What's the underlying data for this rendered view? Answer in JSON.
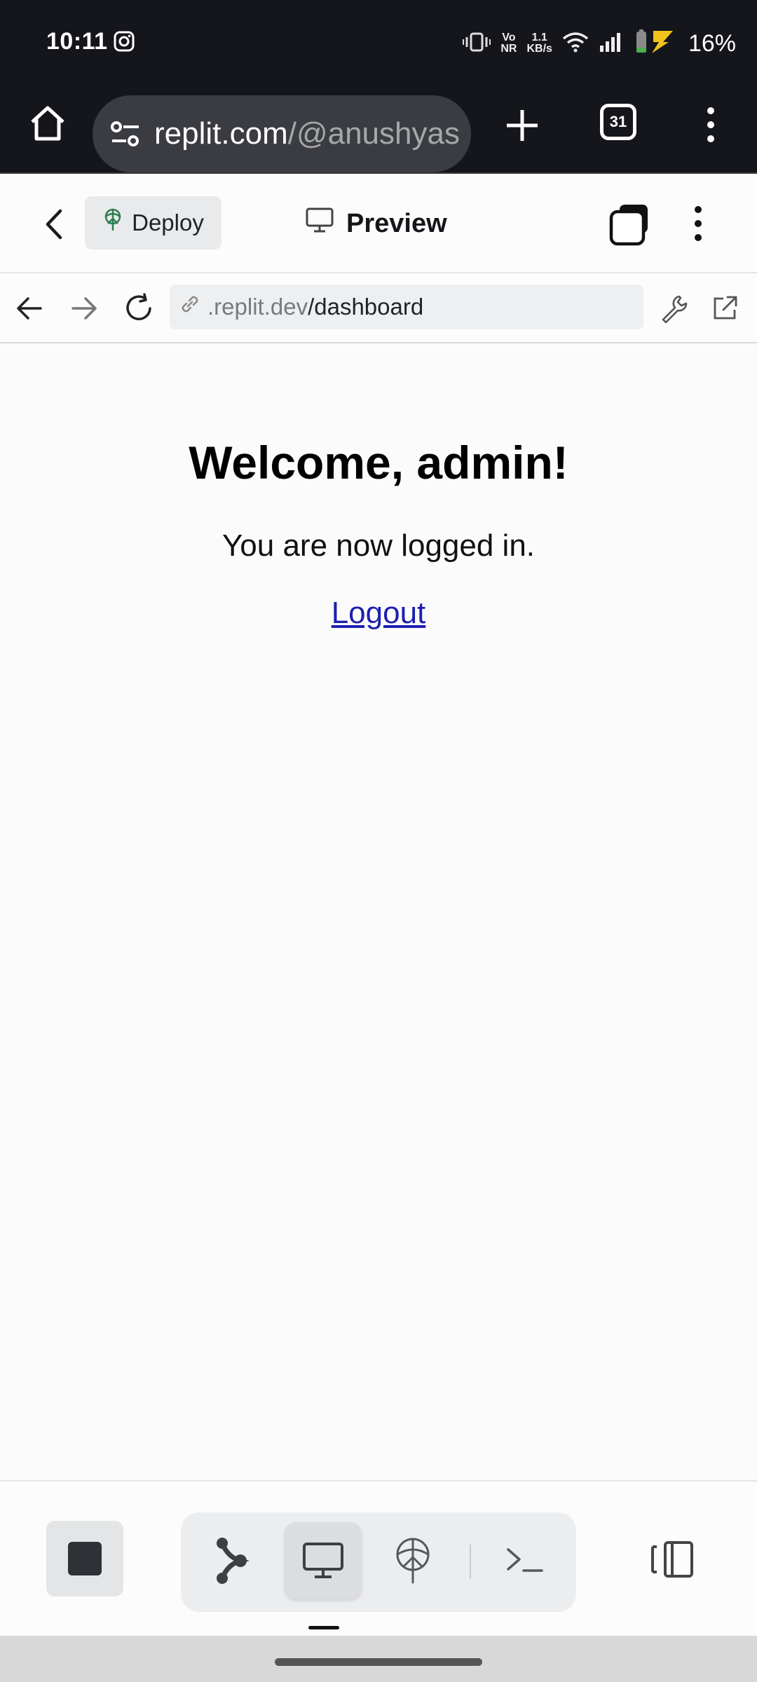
{
  "status_bar": {
    "time": "10:11",
    "network_line1": "Vo",
    "network_line2": "NR",
    "speed_line1": "1.1",
    "speed_line2": "KB/s",
    "battery": "16%"
  },
  "browser": {
    "url_host": "replit.com",
    "url_path": "/@anushyas",
    "tab_count": "31"
  },
  "header": {
    "deploy_label": "Deploy",
    "preview_label": "Preview"
  },
  "webview": {
    "url_prefix": ".replit.dev",
    "url_path": "/dashboard"
  },
  "page": {
    "heading": "Welcome, admin!",
    "message": "You are now logged in.",
    "logout_link": "Logout"
  },
  "colors": {
    "status_bg": "#15161b",
    "link": "#1f1fb0",
    "deploy_icon": "#2e7d4f"
  },
  "icons": [
    "instagram-icon",
    "vibrate-icon",
    "wifi-icon",
    "signal-icon",
    "battery-icon",
    "home-icon",
    "tune-icon",
    "plus-icon",
    "more-vert-icon",
    "chevron-left-icon",
    "deploy-icon",
    "monitor-icon",
    "layers-icon",
    "arrow-left-icon",
    "arrow-right-icon",
    "refresh-icon",
    "link-icon",
    "wrench-icon",
    "external-link-icon",
    "stop-icon",
    "git-branch-icon",
    "globe-upload-icon",
    "terminal-icon",
    "split-view-icon"
  ]
}
